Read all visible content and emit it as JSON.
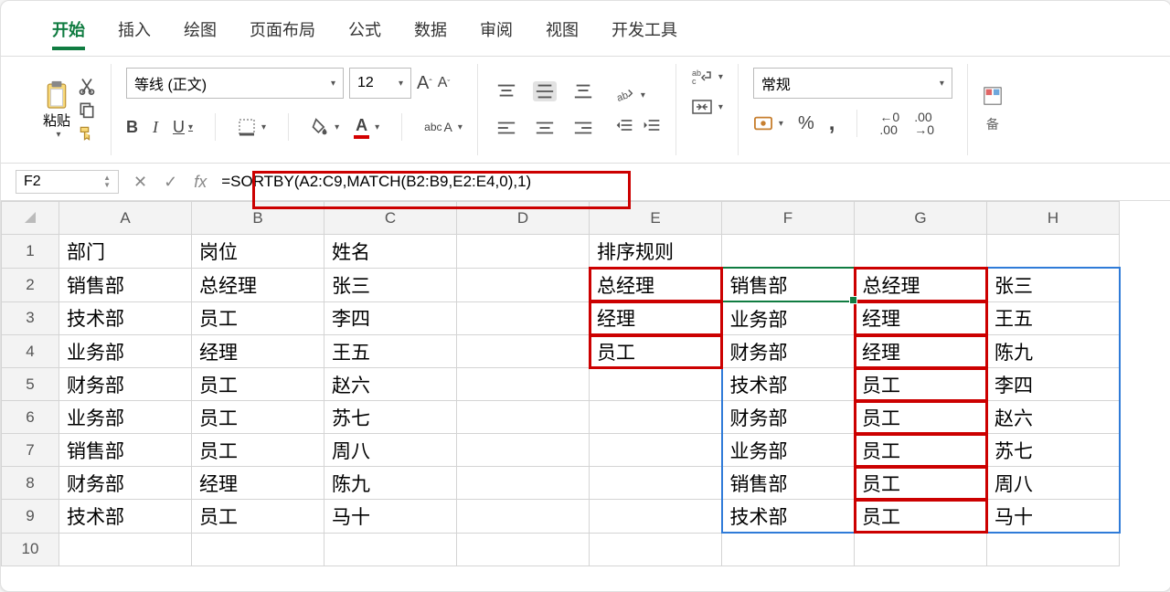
{
  "tabs": {
    "t0": "开始",
    "t1": "插入",
    "t2": "绘图",
    "t3": "页面布局",
    "t4": "公式",
    "t5": "数据",
    "t6": "审阅",
    "t7": "视图",
    "t8": "开发工具"
  },
  "ribbon": {
    "paste_label": "粘贴",
    "font_name": "等线 (正文)",
    "font_size": "12",
    "bold": "B",
    "italic": "I",
    "underline": "U",
    "number_format": "常规",
    "share_hint": "备"
  },
  "namebox": "F2",
  "fx_label": "fx",
  "formula": "=SORTBY(A2:C9,MATCH(B2:B9,E2:E4,0),1)",
  "columns": [
    "A",
    "B",
    "C",
    "D",
    "E",
    "F",
    "G",
    "H"
  ],
  "rows": [
    {
      "n": "1",
      "A": "部门",
      "B": "岗位",
      "C": "姓名",
      "D": "",
      "E": "排序规则",
      "F": "",
      "G": "",
      "H": ""
    },
    {
      "n": "2",
      "A": "销售部",
      "B": "总经理",
      "C": "张三",
      "D": "",
      "E": "总经理",
      "F": "销售部",
      "G": "总经理",
      "H": "张三"
    },
    {
      "n": "3",
      "A": "技术部",
      "B": "员工",
      "C": "李四",
      "D": "",
      "E": "经理",
      "F": "业务部",
      "G": "经理",
      "H": "王五"
    },
    {
      "n": "4",
      "A": "业务部",
      "B": "经理",
      "C": "王五",
      "D": "",
      "E": "员工",
      "F": "财务部",
      "G": "经理",
      "H": "陈九"
    },
    {
      "n": "5",
      "A": "财务部",
      "B": "员工",
      "C": "赵六",
      "D": "",
      "E": "",
      "F": "技术部",
      "G": "员工",
      "H": "李四"
    },
    {
      "n": "6",
      "A": "业务部",
      "B": "员工",
      "C": "苏七",
      "D": "",
      "E": "",
      "F": "财务部",
      "G": "员工",
      "H": "赵六"
    },
    {
      "n": "7",
      "A": "销售部",
      "B": "员工",
      "C": "周八",
      "D": "",
      "E": "",
      "F": "业务部",
      "G": "员工",
      "H": "苏七"
    },
    {
      "n": "8",
      "A": "财务部",
      "B": "经理",
      "C": "陈九",
      "D": "",
      "E": "",
      "F": "销售部",
      "G": "员工",
      "H": "周八"
    },
    {
      "n": "9",
      "A": "技术部",
      "B": "员工",
      "C": "马十",
      "D": "",
      "E": "",
      "F": "技术部",
      "G": "员工",
      "H": "马十"
    },
    {
      "n": "10",
      "A": "",
      "B": "",
      "C": "",
      "D": "",
      "E": "",
      "F": "",
      "G": "",
      "H": ""
    }
  ]
}
